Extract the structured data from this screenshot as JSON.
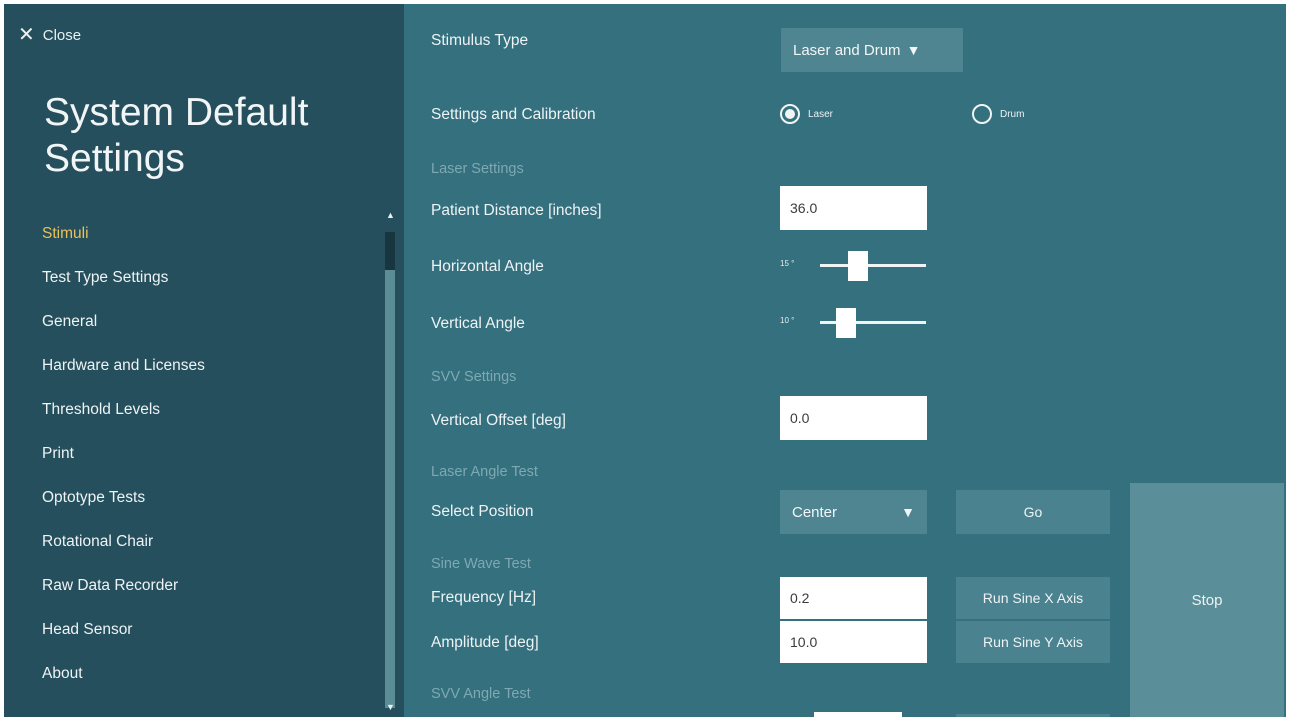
{
  "sidebar": {
    "close_label": "Close",
    "title": "System Default Settings",
    "items": [
      {
        "label": "Stimuli",
        "active": true
      },
      {
        "label": "Test Type Settings"
      },
      {
        "label": "General"
      },
      {
        "label": "Hardware and Licenses"
      },
      {
        "label": "Threshold Levels"
      },
      {
        "label": "Print"
      },
      {
        "label": "Optotype Tests"
      },
      {
        "label": "Rotational Chair"
      },
      {
        "label": "Raw Data Recorder"
      },
      {
        "label": "Head Sensor"
      },
      {
        "label": "About"
      }
    ]
  },
  "main": {
    "stimulus_type_label": "Stimulus Type",
    "stimulus_type_value": "Laser and Drum",
    "settings_calibration_label": "Settings and Calibration",
    "radio_laser": "Laser",
    "radio_drum": "Drum",
    "selected_radio": "Laser",
    "laser_settings_header": "Laser Settings",
    "patient_distance_label": "Patient Distance  [inches]",
    "patient_distance_value": "36.0",
    "horizontal_angle_label": "Horizontal Angle",
    "horizontal_angle_value": "15 °",
    "vertical_angle_label": "Vertical Angle",
    "vertical_angle_value": "10 °",
    "svv_settings_header": "SVV Settings",
    "vertical_offset_label": "Vertical Offset  [deg]",
    "vertical_offset_value": "0.0",
    "laser_angle_test_header": "Laser Angle Test",
    "select_position_label": "Select Position",
    "select_position_value": "Center",
    "go_label": "Go",
    "sine_wave_header": "Sine Wave Test",
    "frequency_label": "Frequency [Hz]",
    "frequency_value": "0.2",
    "run_sine_x_label": "Run Sine X Axis",
    "amplitude_label": "Amplitude [deg]",
    "amplitude_value": "10.0",
    "run_sine_y_label": "Run Sine Y Axis",
    "stop_label": "Stop",
    "svv_angle_test_header": "SVV Angle Test"
  },
  "colors": {
    "sidebar_bg": "#254f5c",
    "main_bg": "#34707e",
    "active_accent": "#e8c15a"
  },
  "icons": {
    "close": "close-icon",
    "dropdown": "caret-down-icon",
    "scroll_up": "scroll-up-arrow-icon",
    "scroll_down": "scroll-down-arrow-icon"
  }
}
